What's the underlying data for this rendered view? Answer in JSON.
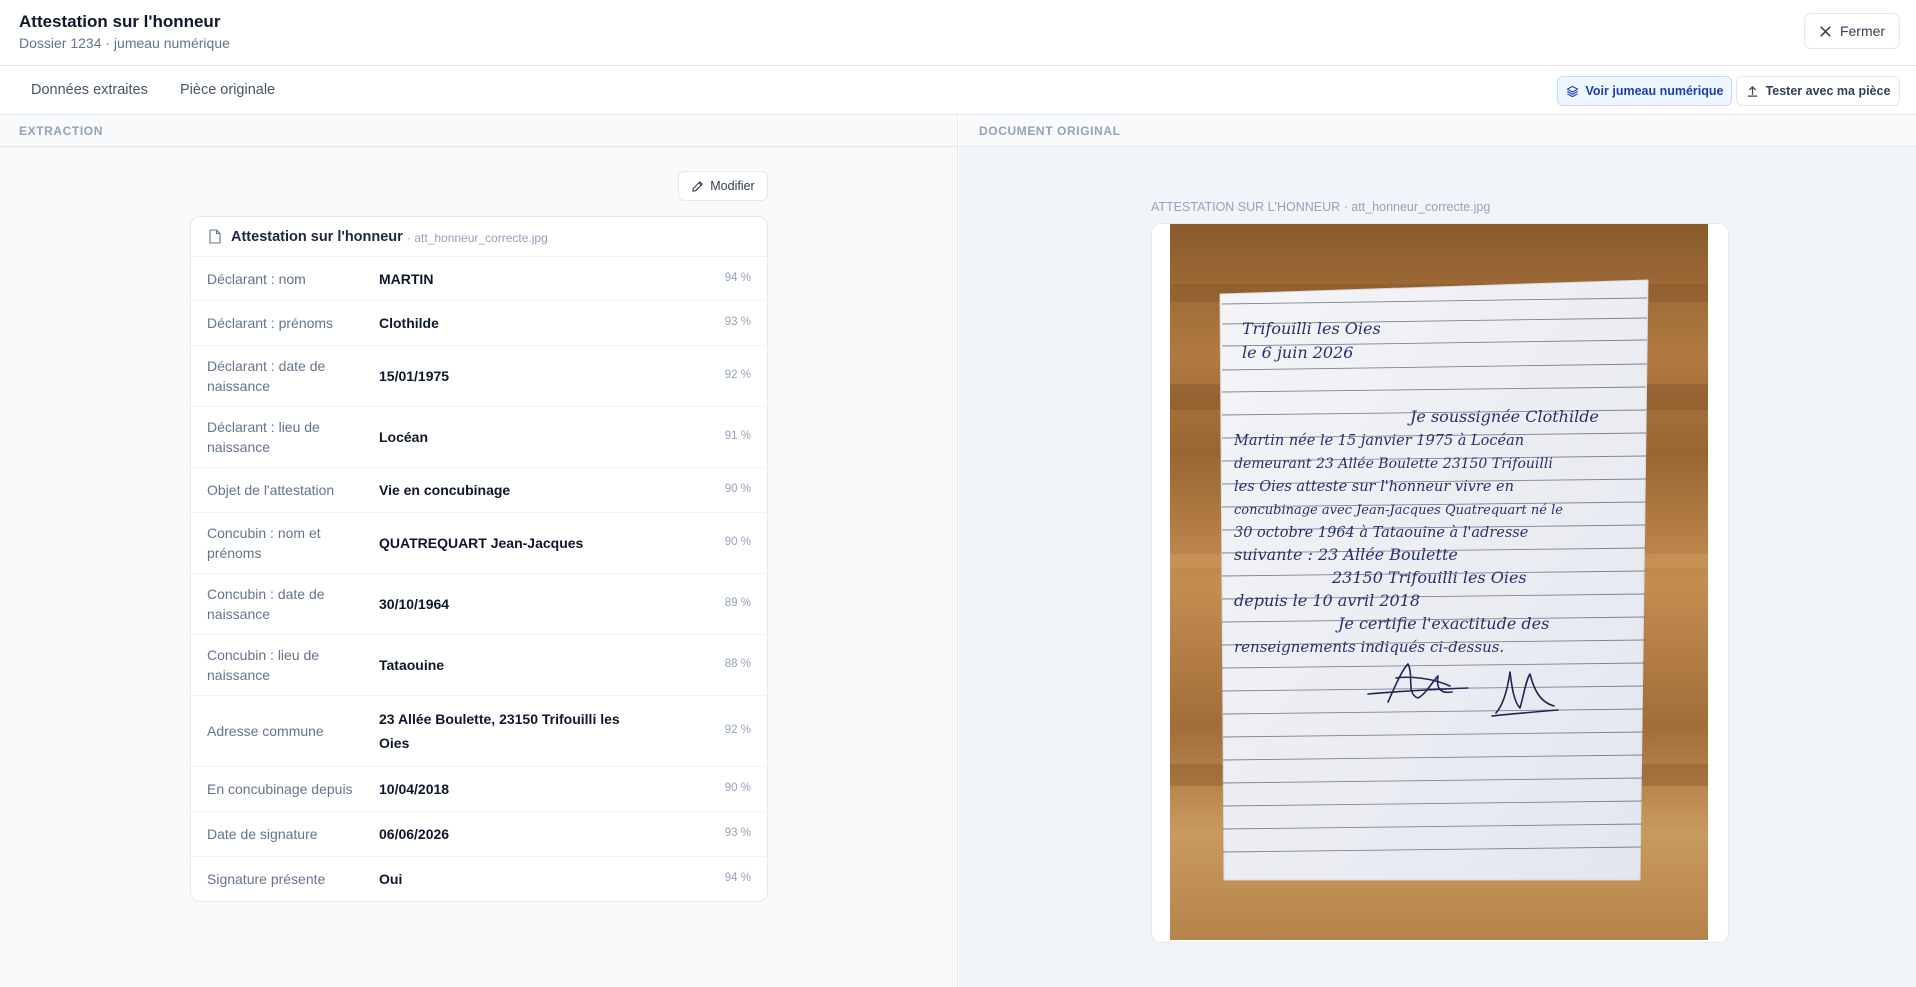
{
  "header": {
    "title": "Attestation sur l'honneur",
    "subtitle": "Dossier 1234 · jumeau numérique",
    "close_label": "Fermer"
  },
  "tabs": [
    {
      "label": "Données extraites"
    },
    {
      "label": "Pièce originale"
    }
  ],
  "toolbar": {
    "twin_label": "Voir jumeau numérique",
    "test_label": "Tester avec ma pièce"
  },
  "extraction": {
    "section_label": "EXTRACTION",
    "modify_label": "Modifier",
    "card_title": "Attestation sur l'honneur",
    "card_file": "· att_honneur_correcte.jpg",
    "fields": [
      {
        "label": "Déclarant : nom",
        "value": "MARTIN",
        "confidence": "94 %"
      },
      {
        "label": "Déclarant : prénoms",
        "value": "Clothilde",
        "confidence": "93 %"
      },
      {
        "label": "Déclarant : date de naissance",
        "value": "15/01/1975",
        "confidence": "92 %"
      },
      {
        "label": "Déclarant : lieu de naissance",
        "value": "Locéan",
        "confidence": "91 %"
      },
      {
        "label": "Objet de l'attestation",
        "value": "Vie en concubinage",
        "confidence": "90 %"
      },
      {
        "label": "Concubin : nom et prénoms",
        "value": "QUATREQUART Jean-Jacques",
        "confidence": "90 %"
      },
      {
        "label": "Concubin : date de naissance",
        "value": "30/10/1964",
        "confidence": "89 %"
      },
      {
        "label": "Concubin : lieu de naissance",
        "value": "Tataouine",
        "confidence": "88 %"
      },
      {
        "label": "Adresse commune",
        "value": "23 Allée Boulette, 23150 Trifouilli les Oies",
        "confidence": "92 %"
      },
      {
        "label": "En concubinage depuis",
        "value": "10/04/2018",
        "confidence": "90 %"
      },
      {
        "label": "Date de signature",
        "value": "06/06/2026",
        "confidence": "93 %"
      },
      {
        "label": "Signature présente",
        "value": "Oui",
        "confidence": "94 %"
      }
    ]
  },
  "original": {
    "section_label": "DOCUMENT ORIGINAL",
    "preview_label": "ATTESTATION SUR L'HONNEUR · att_honneur_correcte.jpg",
    "handwriting": [
      "Trifouilli les Oies",
      "le 6 juin 2026",
      "Je soussignée Clothilde",
      "Martin née le 15 janvier 1975 à Locéan",
      "demeurant 23 Allée Boulette 23150 Trifouilli",
      "les Oies atteste sur l'honneur vivre en",
      "concubinage avec Jean-Jacques Quatrequart né le",
      "30 octobre 1964 à Tataouine à l'adresse",
      "suivante : 23 Allée Boulette",
      "23150 Trifouilli les Oies",
      "depuis le 10 avril 2018",
      "Je certifie l'exactitude des",
      "renseignements indiqués ci-dessus."
    ]
  }
}
